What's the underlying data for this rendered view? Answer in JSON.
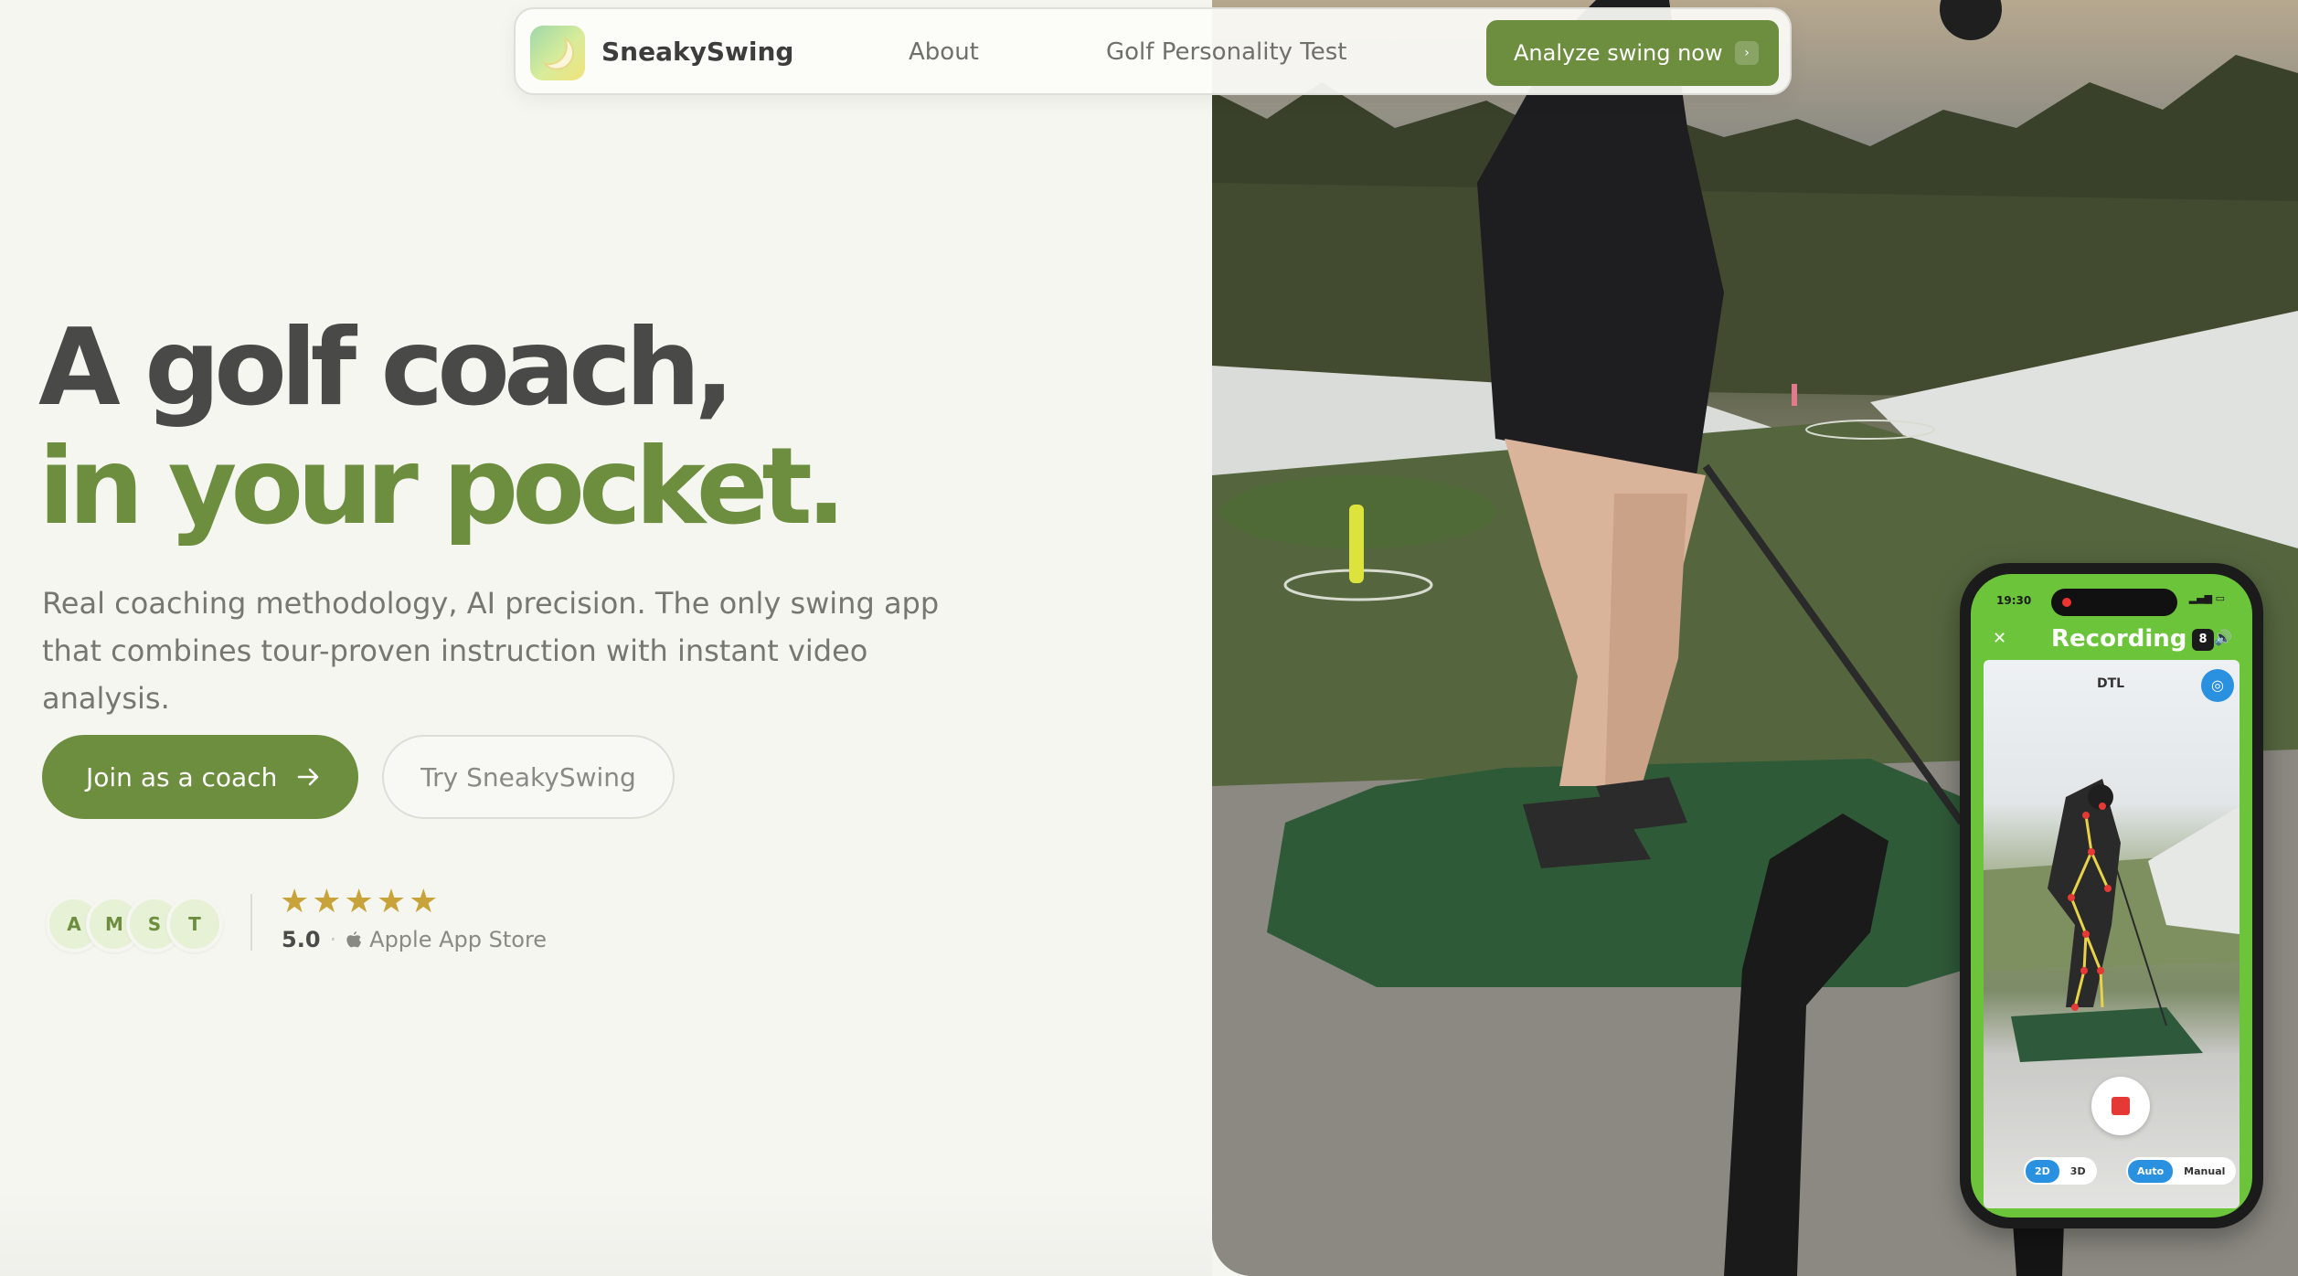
{
  "nav": {
    "brand": "SneakySwing",
    "logo_icon": "moon-icon",
    "links": [
      "About",
      "Golf Personality Test"
    ],
    "cta_label": "Analyze swing now",
    "cta_icon": "chevron-right-icon"
  },
  "hero": {
    "headline_line1": "A golf coach,",
    "headline_line2": "in your pocket.",
    "subtitle": "Real coaching methodology, AI precision. The only swing app that combines tour-proven instruction with instant video analysis.",
    "primary_button": "Join as a coach",
    "primary_button_icon": "arrow-right-icon",
    "secondary_button": "Try SneakySwing"
  },
  "social_proof": {
    "avatars": [
      "A",
      "M",
      "S",
      "T"
    ],
    "stars": "★★★★★",
    "rating_value": 5,
    "rating": "5.0",
    "separator": "·",
    "store_icon": "apple-icon",
    "store": "Apple App Store"
  },
  "phone": {
    "time": "19:30",
    "title": "Recording",
    "count": "8",
    "view_label": "DTL",
    "mode_toggle": [
      "2D",
      "3D"
    ],
    "mode_selected": "2D",
    "capture_toggle": [
      "Auto",
      "Manual"
    ],
    "capture_selected": "Auto"
  },
  "colors": {
    "accent": "#6c8e3e",
    "headline": "#494947",
    "background": "#f6f6f1",
    "star": "#c8a33a"
  }
}
